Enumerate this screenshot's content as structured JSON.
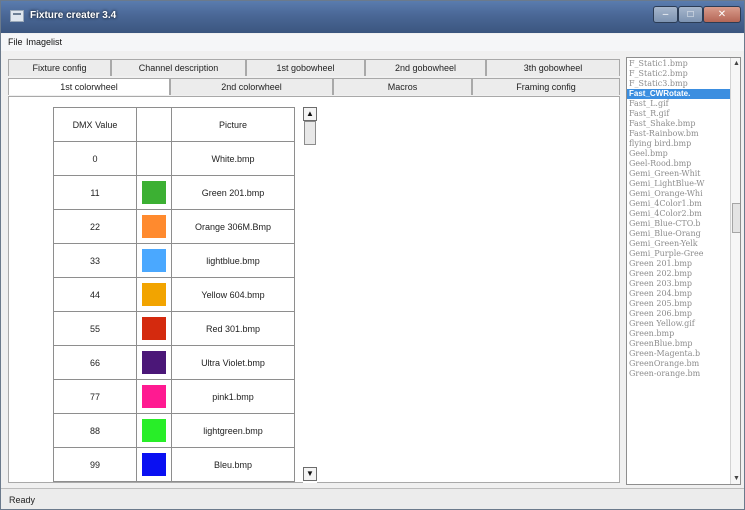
{
  "window": {
    "title": "Fixture creater 3.4"
  },
  "menu": {
    "items": [
      "File",
      "Imagelist"
    ]
  },
  "tabs_row1": [
    "Fixture config",
    "Channel description",
    "1st gobowheel",
    "2nd gobowheel",
    "3th gobowheel"
  ],
  "tabs_row2": [
    "1st colorwheel",
    "2nd colorwheel",
    "Macros",
    "Framing config"
  ],
  "active_tab": "1st colorwheel",
  "table": {
    "headers": [
      "DMX Value",
      "",
      "Picture"
    ],
    "rows": [
      {
        "dmx": "0",
        "color": "#ffffff",
        "picture": "White.bmp"
      },
      {
        "dmx": "11",
        "color": "#3cb033",
        "picture": "Green 201.bmp"
      },
      {
        "dmx": "22",
        "color": "#ff8a2e",
        "picture": "Orange 306M.Bmp"
      },
      {
        "dmx": "33",
        "color": "#4aa8ff",
        "picture": "lightblue.bmp"
      },
      {
        "dmx": "44",
        "color": "#f2a400",
        "picture": "Yellow 604.bmp"
      },
      {
        "dmx": "55",
        "color": "#d42a0e",
        "picture": "Red 301.bmp"
      },
      {
        "dmx": "66",
        "color": "#4b1778",
        "picture": "Ultra Violet.bmp"
      },
      {
        "dmx": "77",
        "color": "#ff1a91",
        "picture": "pink1.bmp"
      },
      {
        "dmx": "88",
        "color": "#28ee28",
        "picture": "lightgreen.bmp"
      },
      {
        "dmx": "99",
        "color": "#0a10f2",
        "picture": "Bleu.bmp"
      }
    ]
  },
  "imagelist": {
    "selected_index": 3,
    "items": [
      "F_Static1.bmp",
      "F_Static2.bmp",
      "F_Static3.bmp",
      "Fast_CWRotate.",
      "Fast_L.gif",
      "Fast_R.gif",
      "Fast_Shake.bmp",
      "Fast-Rainbow.bm",
      "flying bird.bmp",
      "Geel.bmp",
      "Geel-Rood.bmp",
      "Gemi_Green-Whit",
      "Gemi_LightBlue-W",
      "Gemi_Orange-Whi",
      "Gemi_4Color1.bm",
      "Gemi_4Color2.bm",
      "Gemi_Blue-CTO.b",
      "Gemi_Blue-Orang",
      "Gemi_Green-Yelk",
      "Gemi_Purple-Gree",
      "Green 201.bmp",
      "Green 202.bmp",
      "Green 203.bmp",
      "Green 204.bmp",
      "Green 205.bmp",
      "Green 206.bmp",
      "Green Yellow.gif",
      "Green.bmp",
      "GreenBlue.bmp",
      "Green-Magenta.b",
      "GreenOrange.bm",
      "Green-orange.bm"
    ]
  },
  "status": {
    "text": "Ready"
  }
}
